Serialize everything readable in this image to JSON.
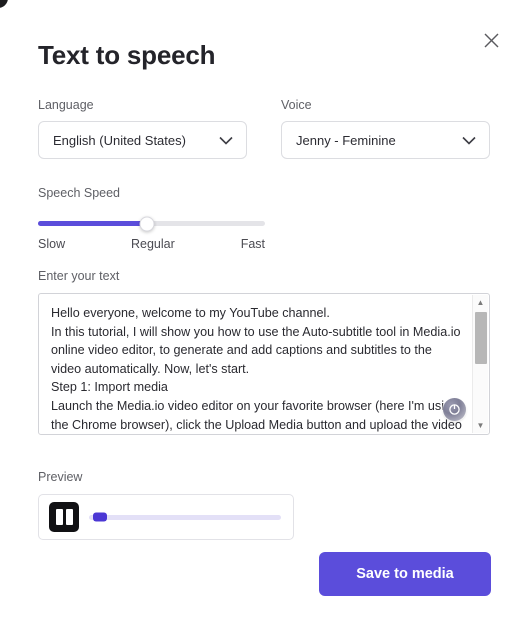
{
  "dialog": {
    "title": "Text to speech",
    "close_label": "×"
  },
  "language": {
    "label": "Language",
    "value": "English (United States)"
  },
  "voice": {
    "label": "Voice",
    "value": "Jenny - Feminine"
  },
  "speed": {
    "label": "Speech Speed",
    "min_label": "Slow",
    "mid_label": "Regular",
    "max_label": "Fast",
    "percent": 48
  },
  "text": {
    "label": "Enter your text",
    "value": "Hello everyone, welcome to my YouTube channel.\nIn this tutorial, I will show you how to use the Auto-subtitle tool in Media.io online video editor, to generate and add captions and subtitles to the video automatically. Now, let's start.\nStep 1: Import media\nLaunch the Media.io video editor on your favorite browser (here I'm using the Chrome browser), click the Upload Media button and upload the video or the audio file. If you have already posted the"
  },
  "preview": {
    "label": "Preview",
    "progress_percent": 2
  },
  "actions": {
    "save_label": "Save to media"
  },
  "colors": {
    "accent": "#5b4ddb",
    "progress_thumb": "#4b37d4",
    "progress_track": "#e3e0f7",
    "slider_track": "#e4e4e8",
    "pause_button": "#111114",
    "title_text": "#24242a",
    "label_text": "#5f6066"
  }
}
